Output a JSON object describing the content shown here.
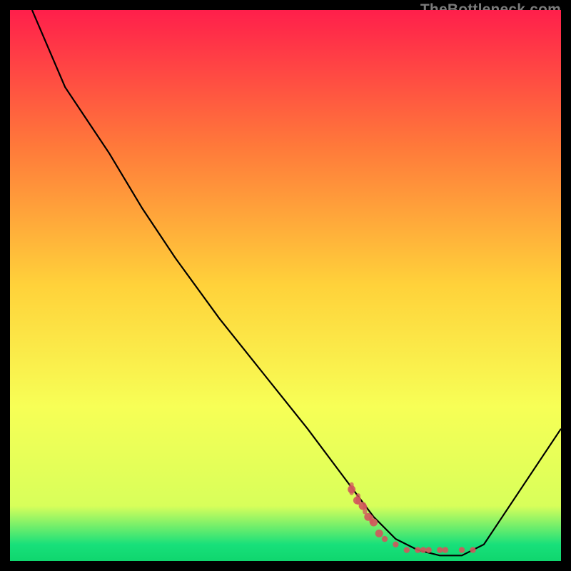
{
  "watermark": "TheBottleneck.com",
  "colors": {
    "top": "#ff1f4b",
    "mid_upper": "#ff7a3a",
    "mid": "#ffd23a",
    "mid_lower": "#f7ff56",
    "near_bottom": "#d8ff5a",
    "bottom_green": "#18e07a",
    "bottom_green2": "#0fd66e",
    "curve": "#000000",
    "dots": "#d1565c"
  },
  "chart_data": {
    "type": "line",
    "title": "",
    "xlabel": "",
    "ylabel": "",
    "xlim": [
      0,
      100
    ],
    "ylim": [
      0,
      100
    ],
    "series": [
      {
        "name": "bottleneck-curve",
        "x": [
          4,
          10,
          18,
          24,
          30,
          38,
          46,
          54,
          60,
          66,
          70,
          74,
          78,
          82,
          86,
          100
        ],
        "y": [
          100,
          86,
          74,
          64,
          55,
          44,
          34,
          24,
          16,
          8,
          4,
          2,
          1,
          1,
          3,
          24
        ]
      }
    ],
    "points_cluster": {
      "name": "highlight-dots",
      "x": [
        62,
        63,
        64,
        65,
        66,
        67,
        68,
        70,
        72,
        74,
        75,
        76,
        78,
        79,
        82,
        84
      ],
      "y": [
        13,
        11,
        10,
        8,
        7,
        5,
        4,
        3,
        2,
        2,
        2,
        2,
        2,
        2,
        2,
        2
      ]
    }
  }
}
